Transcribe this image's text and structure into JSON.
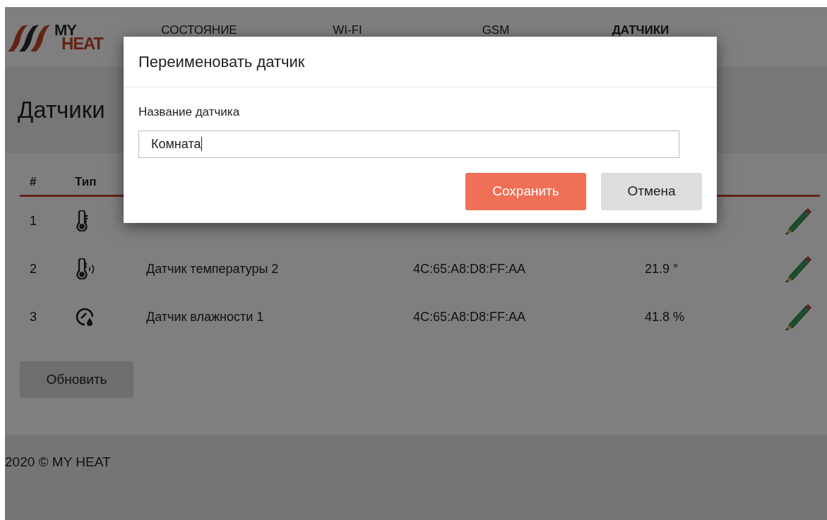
{
  "logo": {
    "top": "MY",
    "bottom": "HEAT"
  },
  "nav": {
    "tabs": [
      {
        "label": "СОСТОЯНИЕ",
        "selected": false
      },
      {
        "label": "WI-FI",
        "selected": false
      },
      {
        "label": "GSM",
        "selected": false
      },
      {
        "label": "ДАТЧИКИ",
        "selected": true
      }
    ]
  },
  "page_title": "Датчики",
  "table": {
    "columns": [
      "#",
      "Тип"
    ],
    "rows": [
      {
        "number": "1",
        "kind": "thermometer"
      },
      {
        "number": "2",
        "kind": "thermometer_wireless",
        "name": "Датчик температуры 2",
        "address": "4C:65:A8:D8:FF:AA",
        "value": "21.9 °"
      },
      {
        "number": "3",
        "kind": "humidity",
        "name": "Датчик влажности 1",
        "address": "4C:65:A8:D8:FF:AA",
        "value": "41.8 %"
      }
    ]
  },
  "refresh_button": "Обновить",
  "footer": "2020 © MY HEAT",
  "dialog": {
    "title": "Переименовать датчик",
    "field_label": "Название датчика",
    "field_value": "Комната",
    "focused": true,
    "buttons": [
      {
        "label": "Сохранить",
        "kind": "primary"
      },
      {
        "label": "Отмена",
        "kind": "secondary"
      }
    ]
  }
}
